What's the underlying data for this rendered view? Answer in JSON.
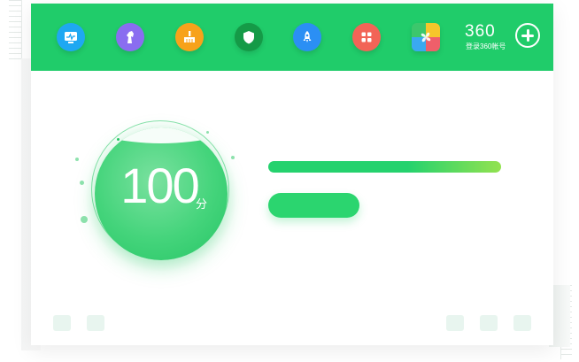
{
  "window": {
    "accent_color": "#20cc6a",
    "background": "#ffffff"
  },
  "toolbar": {
    "icons": [
      {
        "name": "monitor-icon",
        "color": "#1fa8f2"
      },
      {
        "name": "horse-icon",
        "color": "#8a6df0"
      },
      {
        "name": "broom-icon",
        "color": "#f7a21b"
      },
      {
        "name": "shield-icon",
        "color": "#159a47"
      },
      {
        "name": "rocket-icon",
        "color": "#2b8ff4"
      },
      {
        "name": "apps-grid-icon",
        "color": "#f26457"
      },
      {
        "name": "pinwheel-icon",
        "color": "#f6c62b"
      }
    ],
    "brand_number": "360",
    "brand_subtext": "登录360帐号",
    "add_icon": "plus-circle-icon"
  },
  "score": {
    "value": "100",
    "unit": "分"
  },
  "progress": {
    "fraction": 1.0,
    "gradient_start": "#25d26e",
    "gradient_end": "#93e24f"
  }
}
